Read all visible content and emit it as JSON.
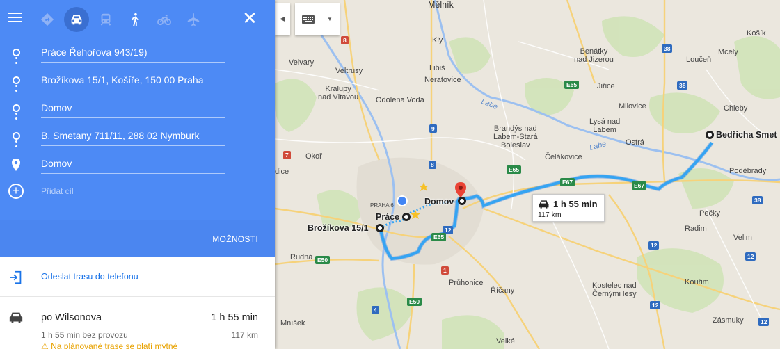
{
  "panel": {
    "modes": [
      "menu-icon",
      "best-route-icon",
      "car-icon",
      "transit-icon",
      "walk-icon",
      "bike-icon",
      "flight-icon"
    ],
    "stops": [
      {
        "value": "Práce   Řehořova 943/19)"
      },
      {
        "value": "Brožíkova 15/1, Košíře, 150 00 Praha"
      },
      {
        "value": "Domov"
      },
      {
        "value": "B. Smetany 711/11, 288 02 Nymburk"
      },
      {
        "value": "Domov"
      }
    ],
    "add_destination": "Přidat cíl",
    "options_label": "MOŽNOSTI",
    "send_to_phone": "Odeslat trasu do telefonu",
    "route": {
      "name": "po Wilsonova",
      "time": "1 h 55 min",
      "subtitle": "1 h 55 min bez provozu",
      "distance": "117 km",
      "warning": "Na plánované trase se platí mýtné"
    },
    "accent": "#4d8af5",
    "accent_dark": "#4b86f0"
  },
  "map": {
    "waypoints": {
      "brozikova": "Brožíkova 15/1",
      "prace": "Práce",
      "domov": "Domov",
      "bedricha": "Bedřicha Smet"
    },
    "callout": {
      "time": "1 h 55 min",
      "distance": "117 km"
    },
    "towns": {
      "melnik": "Mělník",
      "velvary": "Velvary",
      "veltrusy": "Veltrusy",
      "kralupy": "Kralupy\nnad Vltavou",
      "odolena": "Odolena Voda",
      "kly": "Kly",
      "libis": "Libiš",
      "neratovice": "Neratovice",
      "benatky": "Benátky\nnad Jizerou",
      "jirice": "Jiřice",
      "milovice": "Milovice",
      "lysa": "Lysá nad\nLabem",
      "brandys": "Brandýs nad\nLabem-Stará\nBoleslav",
      "celakovice": "Čelákovice",
      "ostra": "Ostrá",
      "kosik": "Košík",
      "mcely": "Mcely",
      "loucen": "Loučeň",
      "chleby": "Chleby",
      "podebrady": "Poděbrady",
      "okor": "Okoř",
      "dice": "dice",
      "praha6": "PRAHA 6",
      "rudna": "Rudná",
      "pruhonice": "Průhonice",
      "ricany": "Říčany",
      "kostelec": "Kostelec nad\nČernými lesy",
      "koufim": "Kouřim",
      "zasmuky": "Zásmuky",
      "pecky": "Pečky",
      "radim": "Radim",
      "velim": "Velim",
      "mnisek": "Mníšek",
      "velke": "Velké"
    },
    "rivers": {
      "labe1": "Labe",
      "labe2": "Labe"
    },
    "shields": {
      "s8a": "8",
      "s9": "9",
      "s8b": "8",
      "s7": "7",
      "s12": "12",
      "s1": "1",
      "s4": "4",
      "e65a": "E65",
      "e65b": "E65",
      "e65c": "E65",
      "e67a": "E67",
      "e67b": "E67",
      "e50a": "E50",
      "e50b": "E50",
      "s38a": "38",
      "s38b": "38",
      "s38c": "38",
      "s12b": "12",
      "s12c": "12",
      "s12d": "12",
      "s12e": "12"
    }
  }
}
